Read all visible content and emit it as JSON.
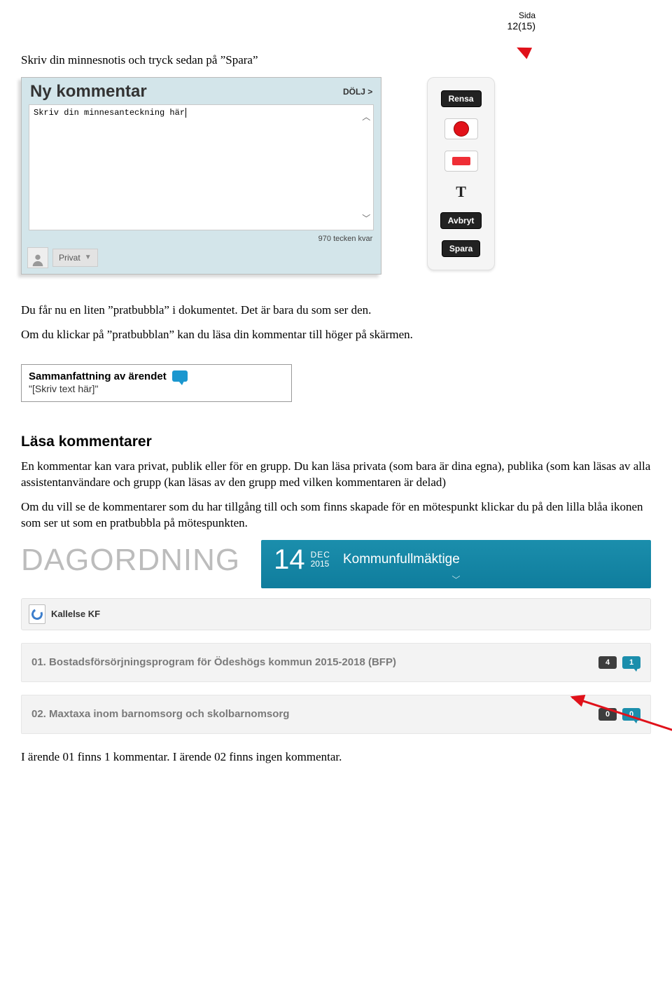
{
  "page": {
    "label": "Sida",
    "number": "12(15)"
  },
  "intro1": "Skriv din minnesnotis och tryck sedan på ”Spara”",
  "ny_kommentar": {
    "title": "Ny kommentar",
    "hide": "DÖLJ >",
    "placeholder_text": "Skriv din minnesanteckning här",
    "counter": "970 tecken kvar",
    "privacy": "Privat"
  },
  "toolbar": {
    "rensa": "Rensa",
    "t": "T",
    "avbryt": "Avbryt",
    "spara": "Spara"
  },
  "para2a": "Du får nu en liten ”pratbubbla” i dokumentet. Det är bara du som ser den.",
  "para2b": "Om du klickar på ”pratbubblan” kan du läsa din kommentar till höger på skärmen.",
  "samman": {
    "title": "Sammanfattning av ärendet",
    "text": "\"[Skriv text här]\""
  },
  "section_heading": "Läsa kommentarer",
  "para3": "En kommentar kan vara privat, publik eller för en grupp. Du kan läsa privata (som bara är dina egna), publika (som kan läsas av alla assistentanvändare och grupp (kan läsas av den grupp med vilken kommentaren är delad)",
  "para4": "Om du vill se de kommentarer som du har tillgång till och som finns skapade för en mötespunkt klickar du på den lilla blåa ikonen som ser ut som en pratbubbla på mötespunkten.",
  "dagordning": {
    "title": "DAGORDNING",
    "day": "14",
    "month": "DEC",
    "year": "2015",
    "meeting": "Kommunfullmäktige",
    "file": "Kallelse KF",
    "items": [
      {
        "label": "01. Bostadsförsörjningsprogram för Ödeshögs kommun 2015-2018 (BFP)",
        "dark": "4",
        "blue": "1"
      },
      {
        "label": "02. Maxtaxa inom barnomsorg och skolbarnomsorg",
        "dark": "0",
        "blue": "0"
      }
    ]
  },
  "closing": "I ärende 01 finns 1 kommentar. I ärende 02 finns ingen kommentar."
}
